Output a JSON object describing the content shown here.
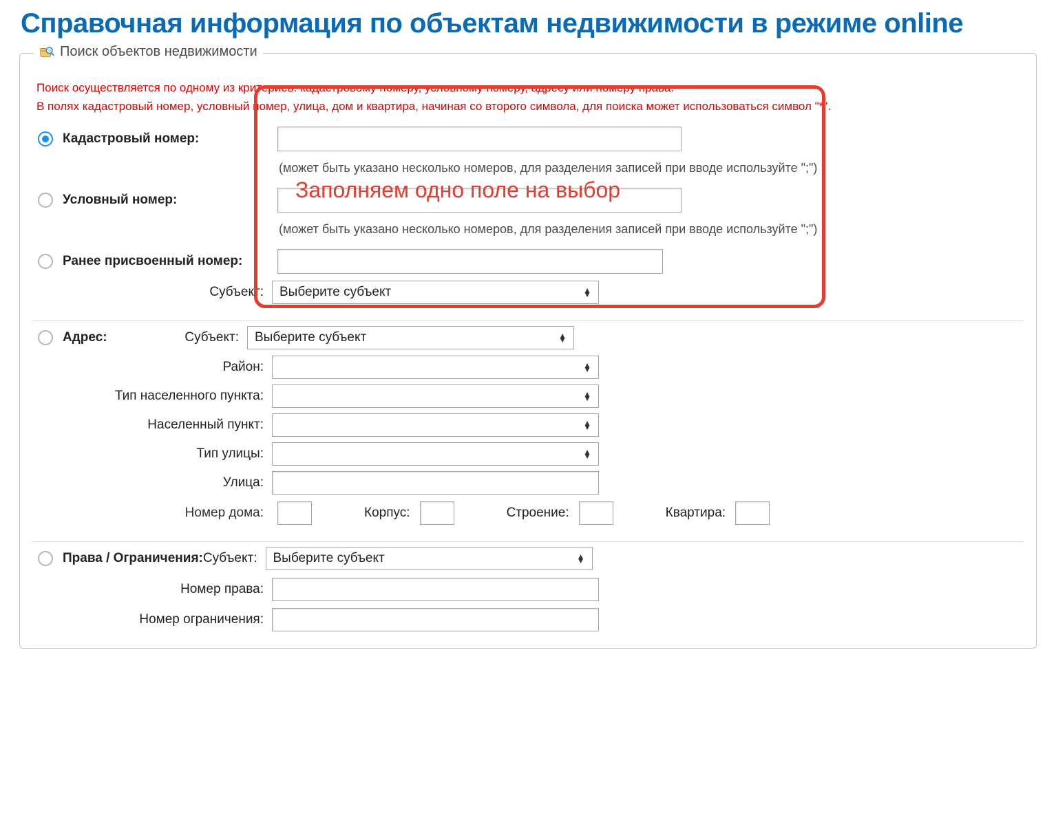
{
  "title": "Справочная информация по объектам недвижимости в режиме online",
  "panel_title": "Поиск объектов недвижимости",
  "instructions_line1": "Поиск осуществляется по одному из критериев: кадастровому номеру, условному номеру, адресу или номеру права.",
  "instructions_line2": "В полях кадастровый номер, условный номер, улица, дом и квартира, начиная со второго символа, для поиска может использоваться символ \"*\".",
  "annotation": "Заполняем одно поле на выбор",
  "criteria": {
    "cadastral": {
      "label": "Кадастровый номер:",
      "hint": "(может быть указано несколько номеров, для разделения записей при вводе используйте \";\")",
      "selected": true
    },
    "conditional": {
      "label": "Условный номер:",
      "hint": "(может быть указано несколько номеров, для разделения записей при вводе используйте \";\")",
      "selected": false
    },
    "previous": {
      "label": "Ранее присвоенный номер:",
      "subject_label": "Субъект:",
      "subject_placeholder": "Выберите субъект",
      "selected": false
    },
    "address": {
      "label": "Адрес:",
      "selected": false,
      "fields": {
        "subject": {
          "label": "Субъект:",
          "placeholder": "Выберите субъект"
        },
        "district": {
          "label": "Район:"
        },
        "settlement_type": {
          "label": "Тип населенного пункта:"
        },
        "settlement": {
          "label": "Населенный пункт:"
        },
        "street_type": {
          "label": "Тип улицы:"
        },
        "street": {
          "label": "Улица:"
        },
        "house": {
          "label": "Номер дома:"
        },
        "building": {
          "label": "Корпус:"
        },
        "structure": {
          "label": "Строение:"
        },
        "flat": {
          "label": "Квартира:"
        }
      }
    },
    "rights": {
      "label": "Права / Ограничения:",
      "selected": false,
      "fields": {
        "subject": {
          "label": "Субъект:",
          "placeholder": "Выберите субъект"
        },
        "right_no": {
          "label": "Номер права:"
        },
        "restriction_no": {
          "label": "Номер ограничения:"
        }
      }
    }
  }
}
